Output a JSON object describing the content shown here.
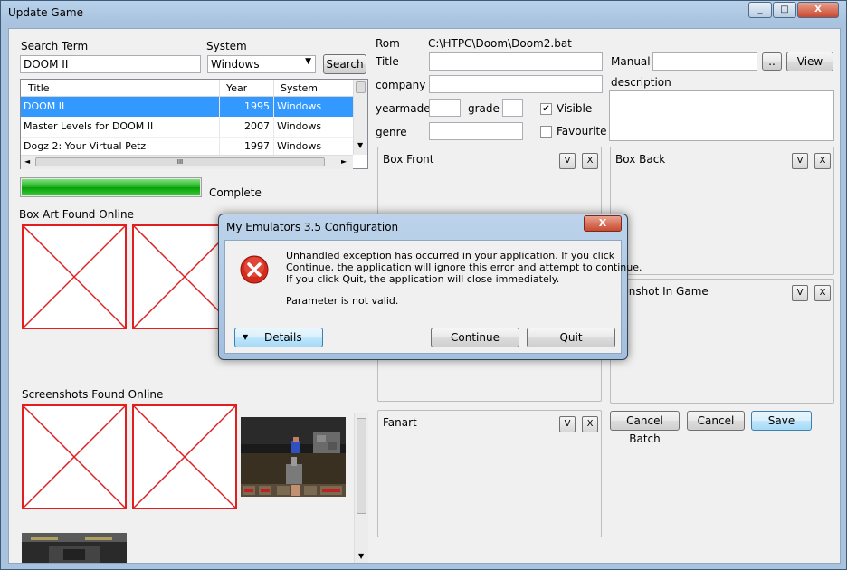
{
  "window": {
    "title": "Update Game"
  },
  "search": {
    "label": "Search Term",
    "value": "DOOM II",
    "system_label": "System",
    "system_value": "Windows",
    "button": "Search"
  },
  "list": {
    "headers": [
      "Title",
      "Year",
      "System"
    ],
    "rows": [
      {
        "title": "DOOM II",
        "year": "1995",
        "system": "Windows"
      },
      {
        "title": "Master Levels for DOOM II",
        "year": "2007",
        "system": "Windows"
      },
      {
        "title": "Dogz 2: Your Virtual Petz",
        "year": "1997",
        "system": "Windows"
      }
    ],
    "hscroll_thumb": "III"
  },
  "progress": {
    "value": 1.0,
    "status": "Complete"
  },
  "sections": {
    "box_art": "Box Art Found Online",
    "screenshots": "Screenshots Found Online"
  },
  "form": {
    "rom_label": "Rom",
    "rom_value": "C:\\HTPC\\Doom\\Doom2.bat",
    "title_label": "Title",
    "company_label": "company",
    "yearmade_label": "yearmade",
    "grade_label": "grade",
    "visible_label": "Visible",
    "visible_checked": true,
    "favourite_label": "Favourite",
    "favourite_checked": false,
    "genre_label": "genre",
    "manual_label": "Manual",
    "browse_button": "..",
    "view_button": "View",
    "description_label": "description"
  },
  "images": {
    "box_front": "Box Front",
    "box_back": "Box Back",
    "screenshot_in_game": "eenshot In Game",
    "fanart": "Fanart",
    "v_label": "V",
    "x_label": "X"
  },
  "buttons": {
    "cancel_batch": "Cancel Batch",
    "cancel": "Cancel",
    "save": "Save"
  },
  "dialog": {
    "title": "My Emulators 3.5 Configuration",
    "lines": [
      "Unhandled exception has occurred in your application. If you click",
      "Continue, the application will ignore this error and attempt to continue.",
      "If you click Quit, the application will close immediately."
    ],
    "error": "Parameter is not valid.",
    "details_button": "Details",
    "continue_button": "Continue",
    "quit_button": "Quit",
    "close_glyph": "X"
  },
  "caption": {
    "minimize": "_",
    "maximize": "□",
    "close": "X"
  },
  "colors": {
    "selection": "#3399ff",
    "progress": "#2bbf2b",
    "placeholder_cross": "#e02020"
  }
}
